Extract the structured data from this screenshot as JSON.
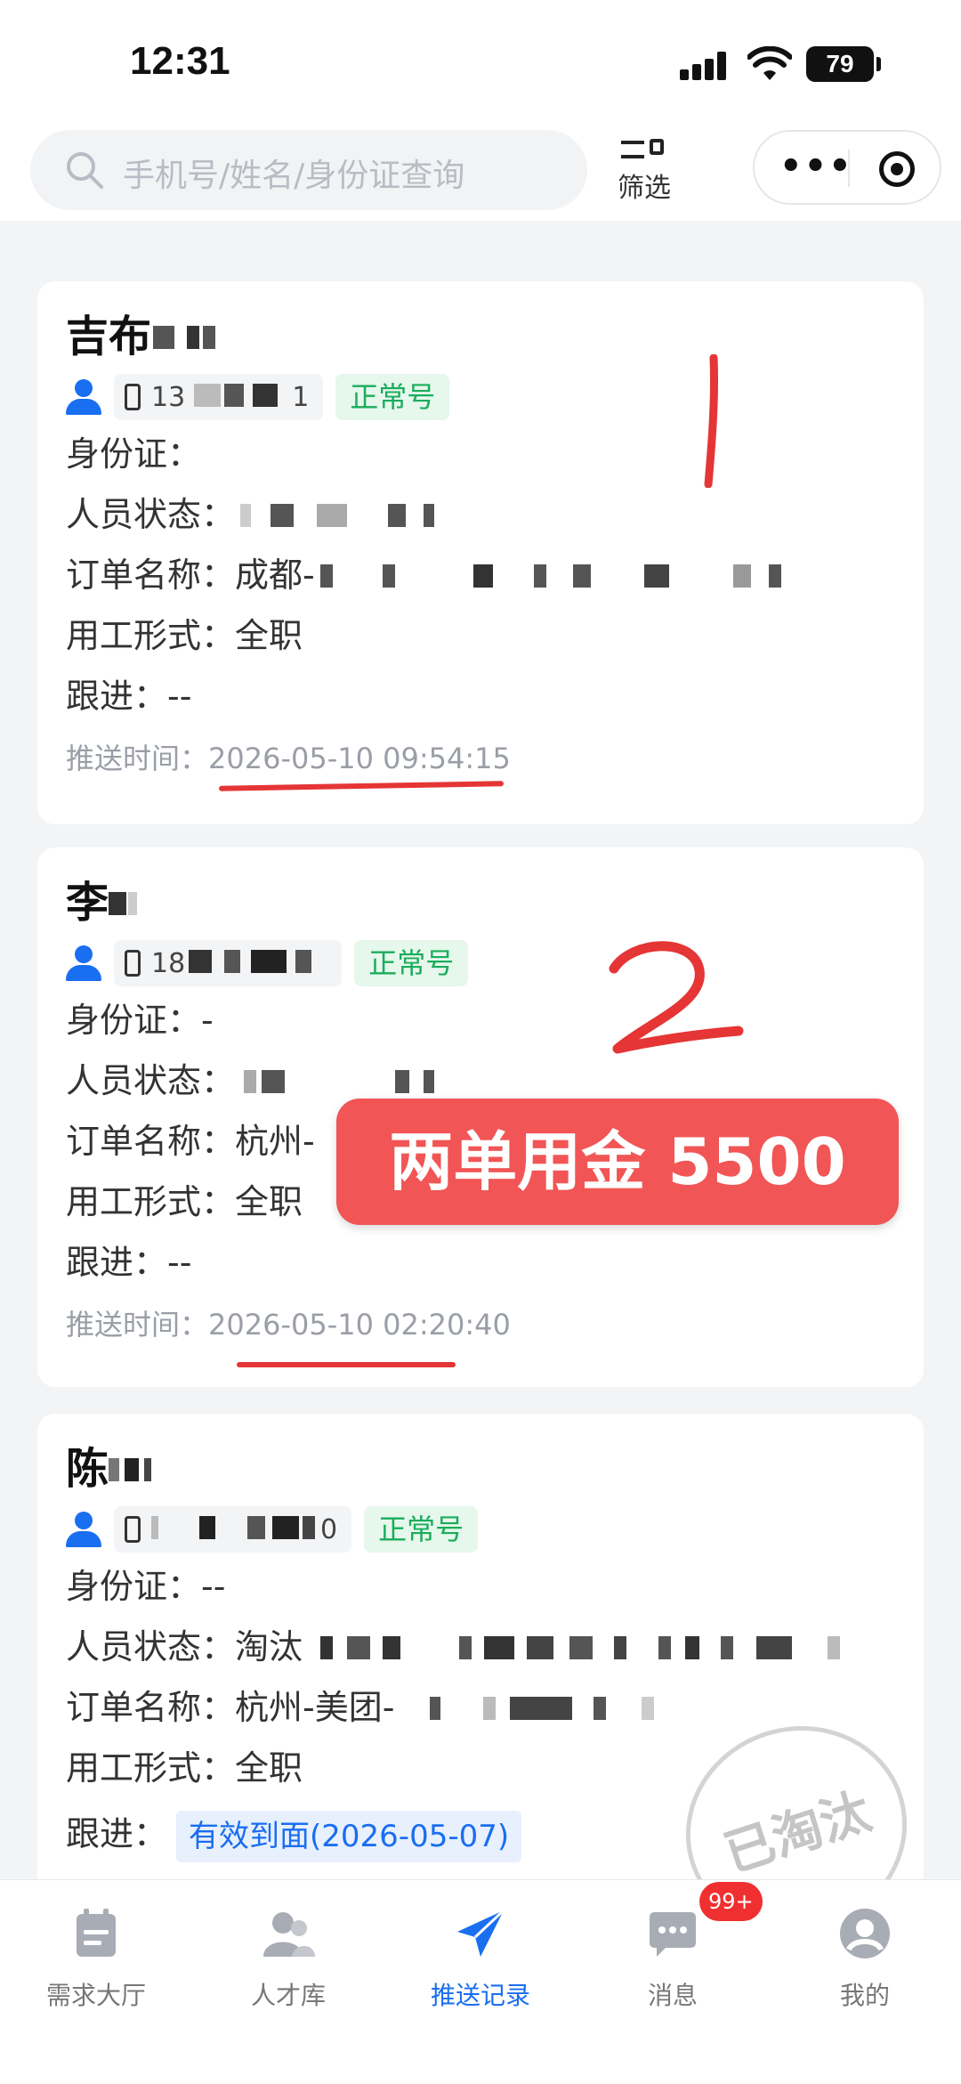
{
  "status_bar": {
    "time": "12:31",
    "battery": "79"
  },
  "search": {
    "placeholder": "手机号/姓名/身份证查询"
  },
  "filter": {
    "label": "筛选"
  },
  "labels": {
    "id_card": "身份证：",
    "staff_status": "人员状态：",
    "order_name": "订单名称：",
    "employment_type": "用工形式：",
    "follow_up": "跟进：",
    "push_time": "推送时间："
  },
  "cards": [
    {
      "name": "吉布",
      "phone": "13",
      "phone_tail": "1",
      "tag": "正常号",
      "id_card": "",
      "staff_status": "",
      "order_name": "成都-",
      "employment_type": "全职",
      "follow_up": "--",
      "push_time": "2026-05-10 09:54:15"
    },
    {
      "name": "李",
      "phone": "18",
      "tag": "正常号",
      "id_card": "-",
      "staff_status": "",
      "order_name": "杭州-",
      "employment_type": "全职",
      "follow_up": "--",
      "push_time": "2026-05-10 02:20:40"
    },
    {
      "name": "陈",
      "phone": "",
      "phone_tail": "0",
      "tag": "正常号",
      "id_card": "--",
      "staff_status": "淘汰",
      "order_name": "杭州-美团-",
      "employment_type": "全职",
      "follow_up_tag": "有效到面(2026-05-07)"
    }
  ],
  "annotations": {
    "mark_1": "1",
    "mark_2": "2",
    "promo": "两单用金 5500"
  },
  "stamp": "已淘汰",
  "tabbar": {
    "items": [
      {
        "label": "需求大厅",
        "icon": "calendar-icon",
        "active": false
      },
      {
        "label": "人才库",
        "icon": "people-icon",
        "active": false
      },
      {
        "label": "推送记录",
        "icon": "send-icon",
        "active": true
      },
      {
        "label": "消息",
        "icon": "chat-icon",
        "active": false
      },
      {
        "label": "我的",
        "icon": "profile-icon",
        "active": false
      }
    ],
    "message_badge": "99+"
  },
  "colors": {
    "accent": "#1a6ef0",
    "tag_green": "#1aad5b",
    "annotation_red": "#e53535",
    "promo_bg": "#f25555"
  }
}
